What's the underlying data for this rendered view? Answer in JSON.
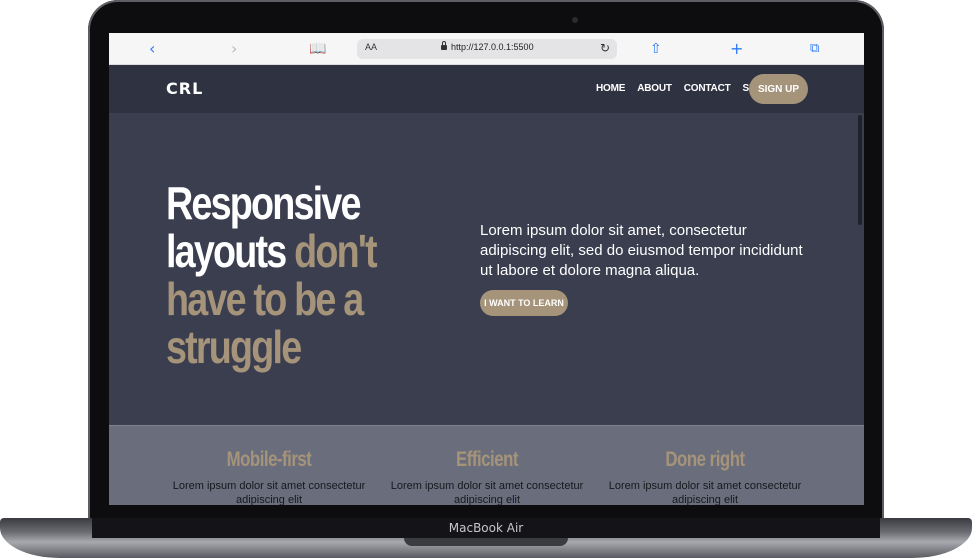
{
  "browser": {
    "url_aa": "AA",
    "url": "http://127.0.0.1:5500"
  },
  "site": {
    "logo": "CRL",
    "nav": [
      "HOME",
      "ABOUT",
      "CONTACT",
      "SIGN IN"
    ],
    "signup": "SIGN UP"
  },
  "hero": {
    "title_white_1": "Responsive",
    "title_white_2": "layouts",
    "title_gold_1": "don't",
    "title_gold_2": "have to be a",
    "title_gold_3": "struggle",
    "text": "Lorem ipsum dolor sit amet, consectetur adipiscing elit, sed do eiusmod tempor incididunt ut labore et dolore magna aliqua.",
    "button": "I WANT TO LEARN"
  },
  "features": [
    {
      "title": "Mobile-first",
      "text": "Lorem ipsum dolor sit amet consectetur adipiscing elit"
    },
    {
      "title": "Efficient",
      "text": "Lorem ipsum dolor sit amet consectetur adipiscing elit"
    },
    {
      "title": "Done right",
      "text": "Lorem ipsum dolor sit amet consectetur adipiscing elit"
    }
  ],
  "device": {
    "label": "MacBook Air"
  },
  "colors": {
    "accent": "#a5937a",
    "hero_bg": "#3a3e4f",
    "nav_bg": "#2f3341",
    "features_bg": "#6a6e7c"
  }
}
